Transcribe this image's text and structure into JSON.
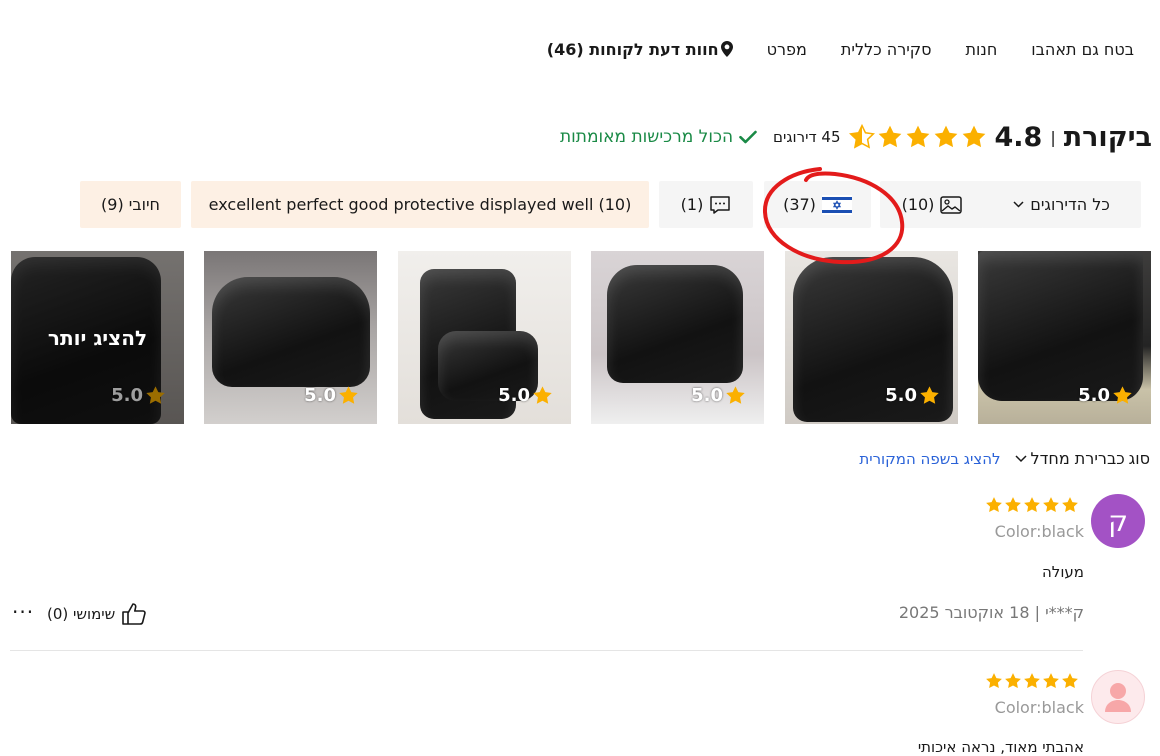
{
  "top_tabs": [
    {
      "label": "חוות דעת לקוחות (46)",
      "active": true
    },
    {
      "label": "מפרט",
      "active": false
    },
    {
      "label": "סקירה כללית",
      "active": false
    },
    {
      "label": "חנות",
      "active": false
    },
    {
      "label": "בטח גם תאהבו",
      "active": false
    }
  ],
  "header": {
    "title": "ביקורת",
    "separator": "|",
    "overall_rating": "4.8",
    "stars_filled": 4.5,
    "rating_count": "45 דירוגים",
    "verified_text": "הכול מרכישות מאומתות",
    "star_color": "#fbb000",
    "verified_color": "#1a8a46"
  },
  "filters": {
    "all_ratings": "כל הדירוגים",
    "photos": "(10)",
    "israel": "(37)",
    "comments": "(1)",
    "keywords": "excellent perfect good protective displayed well (10)",
    "positive": "חיובי (9)"
  },
  "thumbnails": [
    {
      "score": "5.0"
    },
    {
      "score": "5.0"
    },
    {
      "score": "5.0"
    },
    {
      "score": "5.0"
    },
    {
      "score": "5.0"
    },
    {
      "score": "5.0",
      "overlay": "להציג יותר"
    }
  ],
  "sort": {
    "label": "סוג",
    "selected": "כברירת מחדל",
    "original_language": "להציג בשפה המקורית"
  },
  "reviews": [
    {
      "avatar_letter": "ק",
      "avatar_color": "#a352c5",
      "stars": 5,
      "sku": "Color:black",
      "text": "מעולה",
      "meta": "ק***י | 18 אוקטובר 2025",
      "helpful": "שימושי (0)",
      "more": "···"
    },
    {
      "avatar_letter": "",
      "avatar_color": "#fdeaec",
      "stars": 5,
      "sku": "Color:black",
      "text": "אהבתי מאוד, נראה איכותי"
    }
  ]
}
